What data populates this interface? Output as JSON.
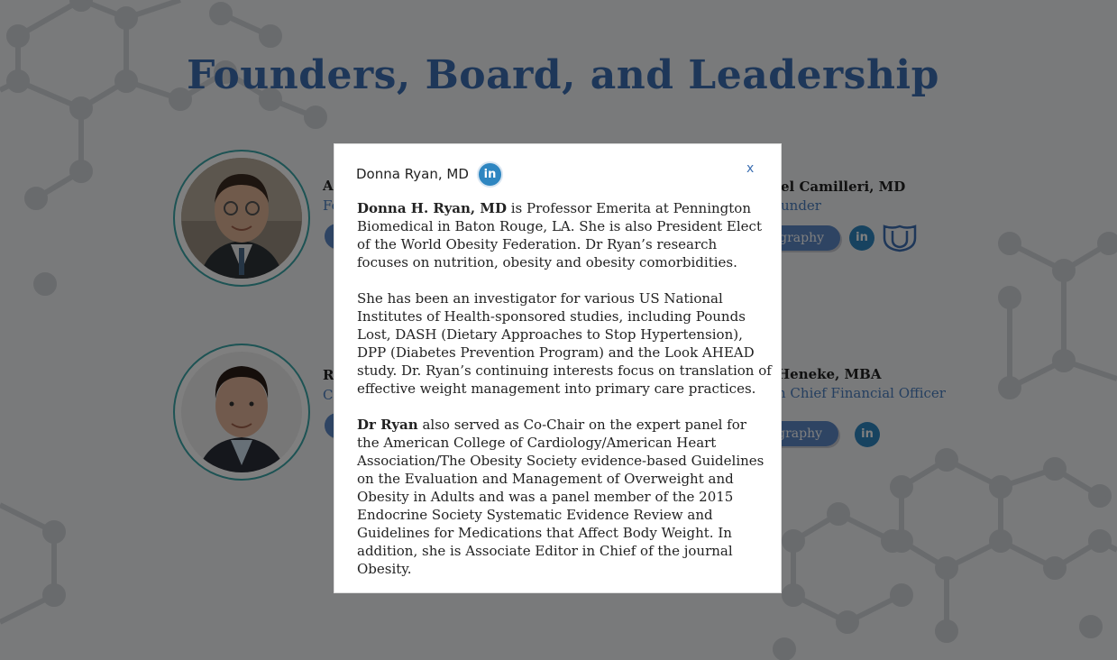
{
  "page": {
    "title": "Founders, Board, and Leadership"
  },
  "members": [
    {
      "name": "A",
      "role": "Fo"
    },
    {
      "name": "el Camilleri, MD",
      "role": "under",
      "bio_label": "graphy",
      "linkedin": "in"
    },
    {
      "name": "R",
      "role": "C"
    },
    {
      "name": "Heneke, MBA",
      "role": "n Chief Financial Officer",
      "bio_label": "graphy",
      "linkedin": "in"
    }
  ],
  "modal": {
    "title": "Donna Ryan, MD",
    "linkedin": "in",
    "close_label": "x",
    "paragraphs": [
      {
        "lead": "Donna H. Ryan, MD",
        "text": " is Professor Emerita at Pennington Biomedical in Baton Rouge, LA. She is also President Elect of the World Obesity Federation. Dr Ryan’s research focuses on nutrition, obesity and obesity comorbidities."
      },
      {
        "lead": "",
        "text": "She has been an investigator for various US National Institutes of Health-sponsored studies, including Pounds Lost, DASH (Dietary Approaches to Stop Hypertension), DPP (Diabetes Prevention Program) and the Look AHEAD study. Dr. Ryan’s continuing interests focus on translation of effective weight management into primary care practices."
      },
      {
        "lead": "Dr Ryan",
        "text": " also served as Co-Chair on the expert panel for the American College of Cardiology/American Heart Association/The Obesity Society evidence-based Guidelines on the Evaluation and Management of Overweight and Obesity in Adults and was a panel member of the 2015 Endocrine Society Systematic Evidence Review and Guidelines for Medications that Affect Body Weight. In addition, she is Associate Editor in Chief of the journal Obesity."
      }
    ]
  },
  "colors": {
    "accent": "#3c6fb2",
    "linkedin": "#2e86c1",
    "avatar_ring": "#3aa6a8",
    "bio_button": "#5d88c6"
  }
}
